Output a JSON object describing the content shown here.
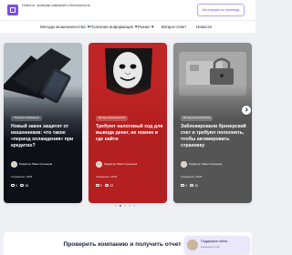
{
  "header": {
    "logo_text": "Новости, проверки компаний и безопасность",
    "report_button": "Инструкция по переводу"
  },
  "nav": {
    "items": [
      {
        "label": "Методы мошенничества",
        "has_dropdown": true
      },
      {
        "label": "Полезная информация",
        "has_dropdown": true
      },
      {
        "label": "Рынки",
        "has_dropdown": true
      },
      {
        "label": "Вопрос-ответ",
        "has_dropdown": false
      },
      {
        "label": "Новости",
        "has_dropdown": false
      }
    ]
  },
  "cards": [
    {
      "tag": "Полезная информация",
      "title": "Новый закон защитит от мошенников: что такое «период охлаждения» при кредитах?",
      "author": "Редактор Павел Кузнецов",
      "date": "9 февраля, 2025",
      "comments": "0",
      "views": "28"
    },
    {
      "tag": "Методы мошенничества",
      "title": "Требуют налоговый ход для вывода денег, не помню и где найти",
      "author": "Редактор Павел Кузнецов",
      "date": "9 февраля, 2025",
      "comments": "0",
      "views": "29"
    },
    {
      "tag": "Методы мошенничества",
      "title": "Заблокировали брокерский счет и требуют пополнить, чтобы активировать страховку",
      "author": "Редактор Павел Кузнецов",
      "date": "9 февраля, 2025",
      "comments": "0",
      "views": "30"
    }
  ],
  "carousel": {
    "dots": 5,
    "active_index": 1
  },
  "check_section": {
    "title": "Проверить компанию и получить отчет"
  },
  "support_widget": {
    "title": "Поддержка сайта",
    "subtitle": "Написать в чат"
  },
  "colors": {
    "accent": "#7a4fe0",
    "card2_red": "#b41f1f",
    "page_bg": "#eef0f4"
  }
}
